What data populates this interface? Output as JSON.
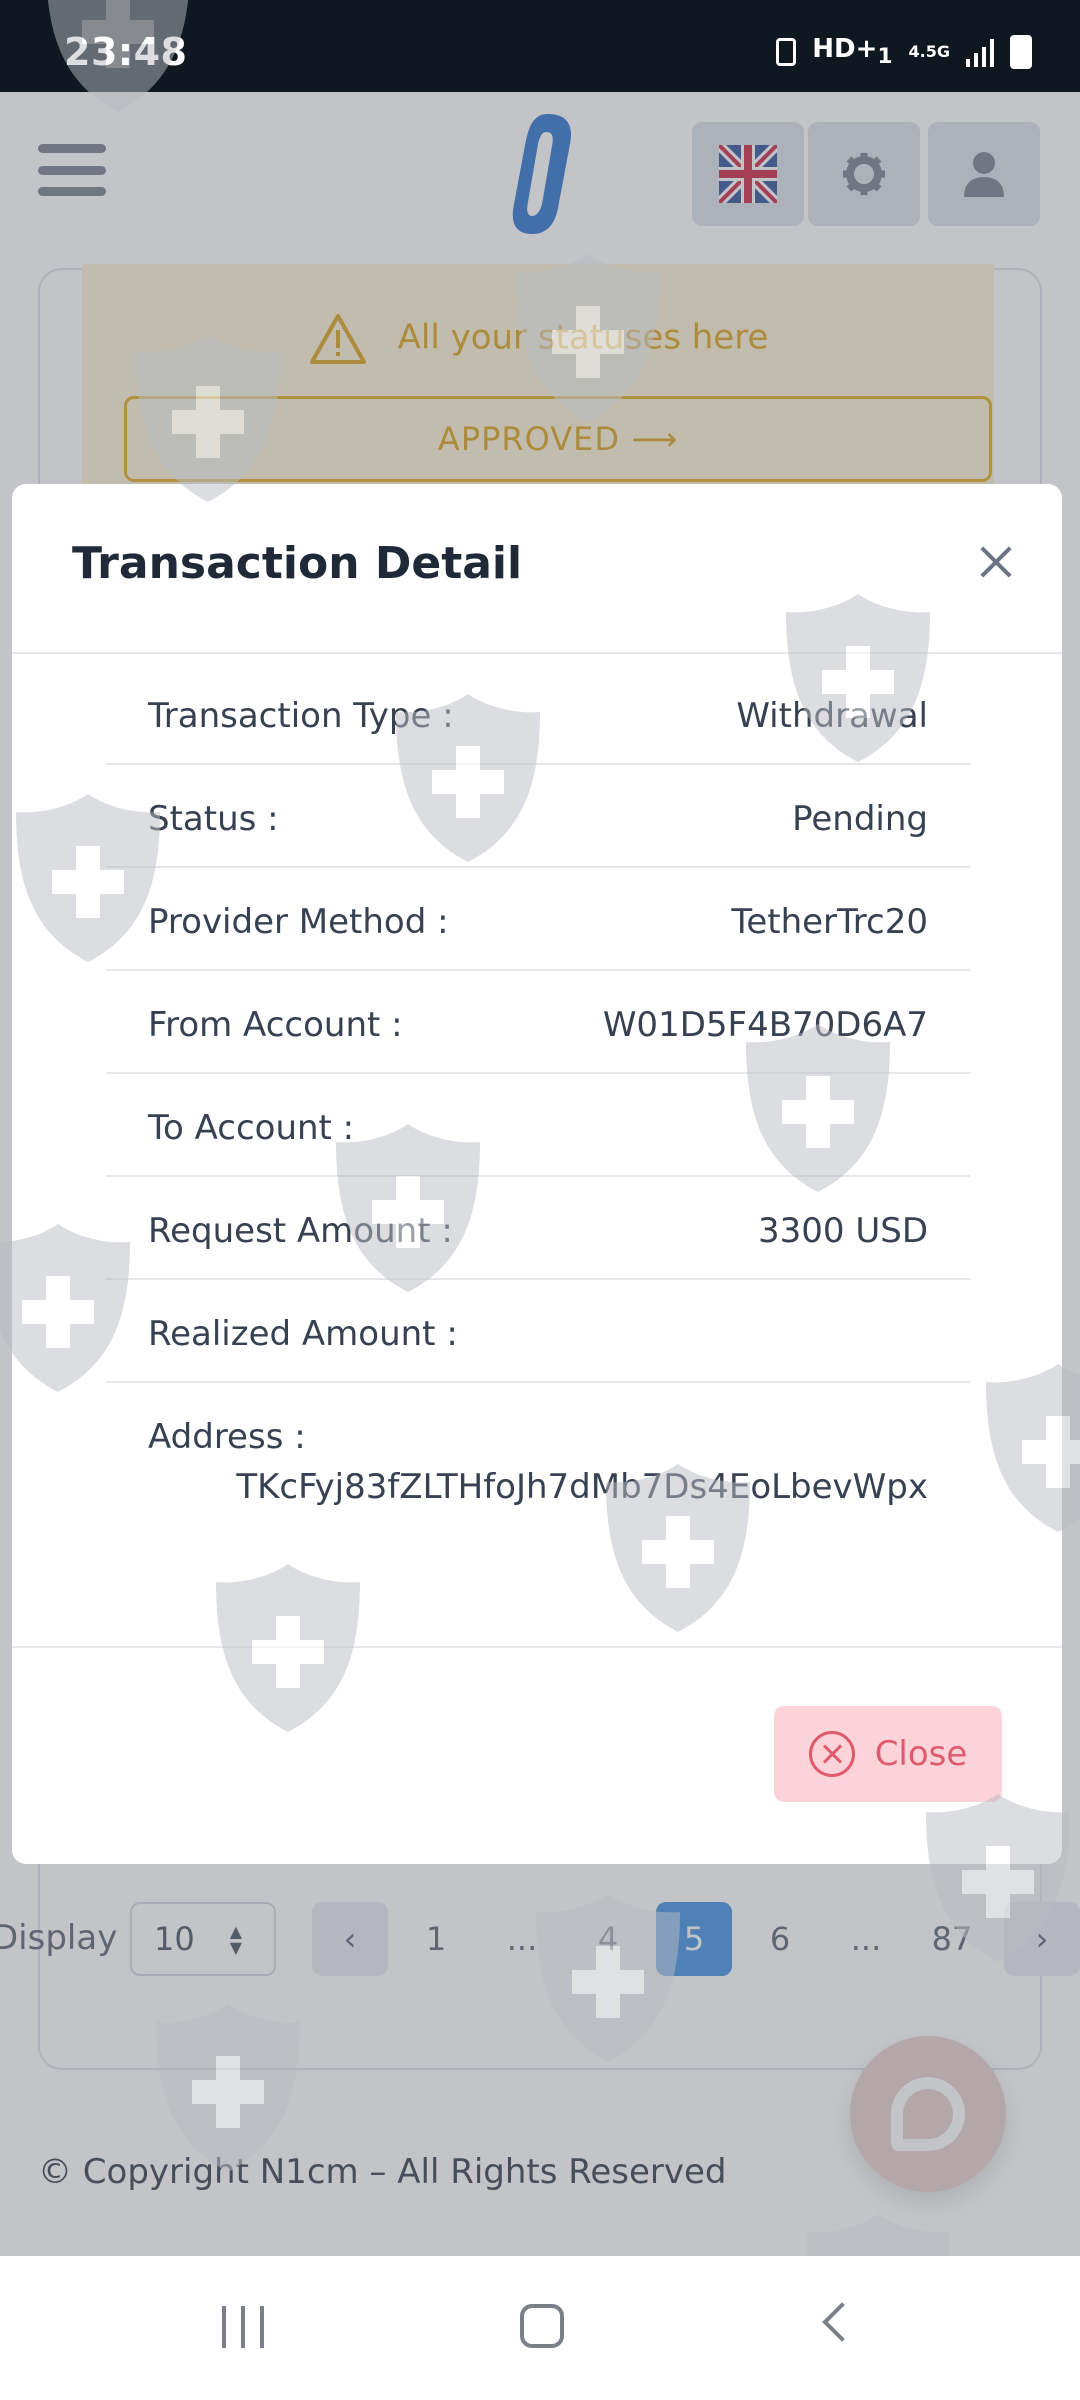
{
  "status_bar": {
    "time": "23:48",
    "hd_label": "HD+",
    "hd_sub": "1",
    "net_label": "4.5G",
    "icons": [
      "sim-icon",
      "hd-voice-icon",
      "network-icon",
      "signal-icon",
      "battery-icon"
    ]
  },
  "header": {
    "menu_icon": "hamburger-icon",
    "logo": "brand-logo",
    "buttons": [
      "language-flag-uk",
      "settings-gear-icon",
      "user-profile-icon"
    ]
  },
  "alert": {
    "text": "All your statuses here",
    "button": "APPROVED ⟶",
    "color": "#d89a00"
  },
  "modal": {
    "title": "Transaction Detail",
    "rows": [
      {
        "label": "Transaction Type :",
        "value": "Withdrawal"
      },
      {
        "label": "Status :",
        "value": "Pending"
      },
      {
        "label": "Provider Method :",
        "value": "TetherTrc20"
      },
      {
        "label": "From Account :",
        "value": "W01D5F4B70D6A7"
      },
      {
        "label": "To Account :",
        "value": ""
      },
      {
        "label": "Request Amount :",
        "value": "3300 USD"
      },
      {
        "label": "Realized Amount :",
        "value": ""
      },
      {
        "label": "Address :",
        "value": "TKcFyj83fZLTHfoJh7dMb7Ds4EoLbevWpx"
      }
    ],
    "close_label": "Close"
  },
  "pagination": {
    "display_label": "Display",
    "page_size": "10",
    "pages": [
      "1",
      "...",
      "4",
      "5",
      "6",
      "...",
      "87"
    ],
    "active_page": "5",
    "accent": "#2f86de"
  },
  "footer": {
    "copyright": "© Copyright N1cm – All Rights Reserved"
  },
  "nav_bar": [
    "recents-icon",
    "home-icon",
    "back-icon"
  ]
}
